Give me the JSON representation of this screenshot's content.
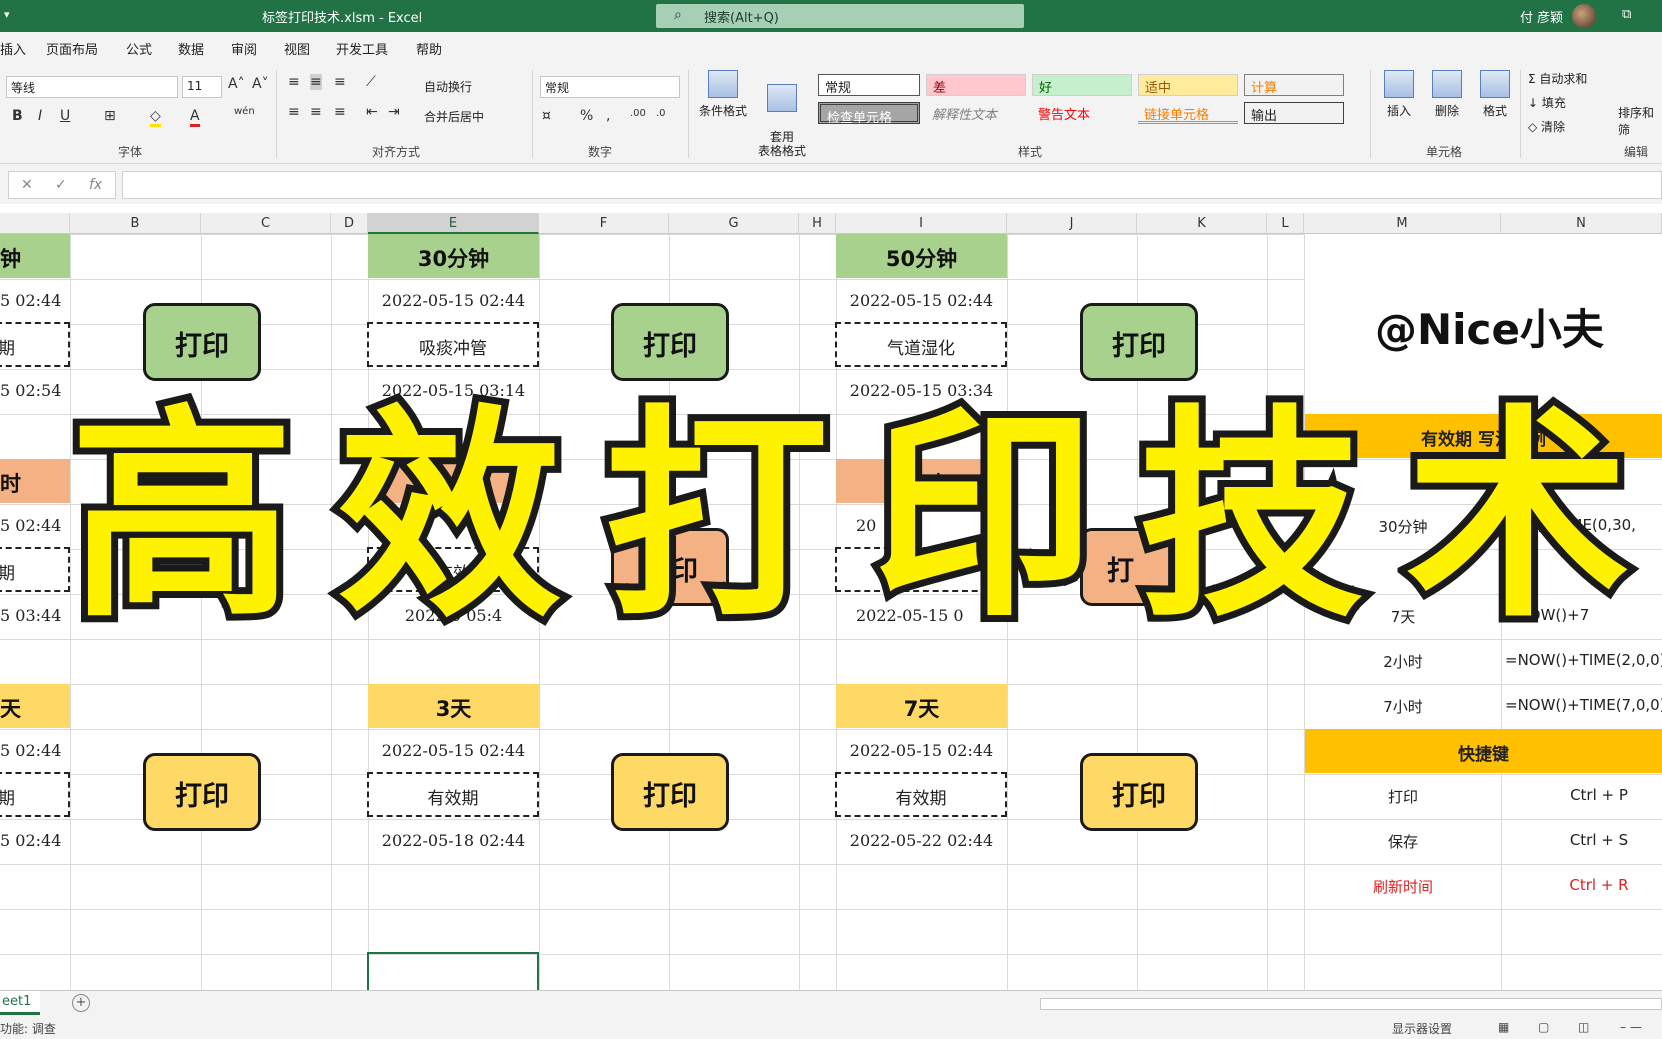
{
  "titlebar": {
    "qat": "▾",
    "title": "标签打印技术.xlsm  -  Excel",
    "search": "搜索(Alt+Q)",
    "user": "付 彦颖",
    "restore": "⧉"
  },
  "menu": [
    "插入",
    "页面布局",
    "公式",
    "数据",
    "审阅",
    "视图",
    "开发工具",
    "帮助"
  ],
  "ribbon": {
    "font_name": "等线",
    "font_size": "11",
    "number_format": "常规",
    "wrap_text": "自动换行",
    "merge_center": "合并后居中",
    "cond_format": "条件格式",
    "table_format": "套用\n表格格式",
    "insert": "插入",
    "delete": "删除",
    "format": "格式",
    "autosum": "Σ 自动求和",
    "fill": "填充",
    "clear": "清除",
    "sort": "排序和筛",
    "groups": {
      "font": "字体",
      "align": "对齐方式",
      "number": "数字",
      "styles": "样式",
      "cells": "单元格",
      "edit": "编辑"
    },
    "styles": {
      "normal": "常规",
      "bad": "差",
      "good": "好",
      "neutral": "适中",
      "calc": "计算",
      "check": "检查单元格",
      "explain": "解释性文本",
      "warn": "警告文本",
      "link": "链接单元格",
      "output": "输出"
    }
  },
  "formula": {
    "cancel": "✕",
    "enter": "✓",
    "fx": "fx",
    "value": ""
  },
  "columns": [
    "B",
    "C",
    "D",
    "E",
    "F",
    "G",
    "H",
    "I",
    "J",
    "K",
    "L",
    "M",
    "N"
  ],
  "blocks": {
    "a1": {
      "head": "钟",
      "t1": "5 02:44",
      "label": "期",
      "t2": "5 02:54"
    },
    "e1": {
      "head": "30分钟",
      "t1": "2022-05-15 02:44",
      "label": "吸痰冲管",
      "t2": "2022-05-15 03:14"
    },
    "i1": {
      "head": "50分钟",
      "t1": "2022-05-15 02:44",
      "label": "气道湿化",
      "t2": "2022-05-15 03:34"
    },
    "a2": {
      "head": "时",
      "t1": "5 02:44",
      "label": "期",
      "t2": "5 03:44"
    },
    "e2": {
      "head": "",
      "t1": "20",
      "label": "有效",
      "t2": "2022-0 05:4"
    },
    "i2": {
      "head": "小时",
      "t1": "20",
      "label": "",
      "t2": "2022-05-15 0"
    },
    "a3": {
      "head": "天",
      "t1": "5 02:44",
      "label": "期",
      "t2": "5 02:44"
    },
    "e3": {
      "head": "3天",
      "t1": "2022-05-15 02:44",
      "label": "有效期",
      "t2": "2022-05-18 02:44"
    },
    "i3": {
      "head": "7天",
      "t1": "2022-05-15 02:44",
      "label": "有效期",
      "t2": "2022-05-22 02:44"
    }
  },
  "print_label": "打印",
  "print_partial_e": "印",
  "print_partial_i": "打",
  "brand": "@Nice小夫",
  "panel": {
    "head1": "有效期 写法示例",
    "rows": [
      {
        "name": "",
        "formula": "+TIME(0,10,"
      },
      {
        "name": "30分钟",
        "formula": "OW()+TIME(0,30,"
      },
      {
        "name": "",
        "formula": "2"
      },
      {
        "name": "7天",
        "formula": "=NOW()+7"
      },
      {
        "name": "2小时",
        "formula": "=NOW()+TIME(2,0,0)"
      },
      {
        "name": "7小时",
        "formula": "=NOW()+TIME(7,0,0)"
      }
    ],
    "head2": "快捷键",
    "keys": [
      {
        "name": "打印",
        "key": "Ctrl + P"
      },
      {
        "name": "保存",
        "key": "Ctrl + S"
      },
      {
        "name": "刷新时间",
        "key": "Ctrl + R"
      }
    ]
  },
  "overlay": [
    "高",
    "效",
    "打",
    "印",
    "技",
    "术"
  ],
  "sheet_tab": "eet1",
  "add_sheet": "+",
  "status": {
    "left": "功能: 调查",
    "display": "显示器设置"
  }
}
